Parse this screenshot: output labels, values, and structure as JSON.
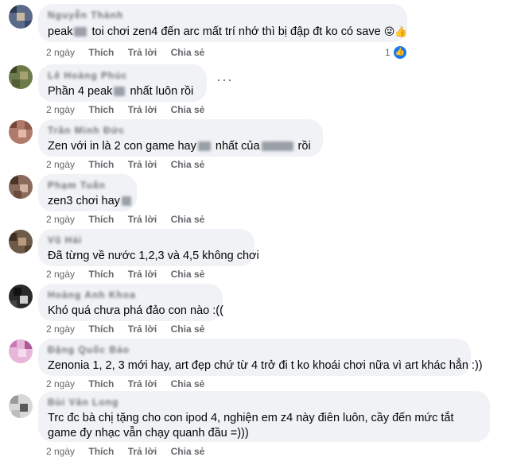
{
  "actions": {
    "time": "2 ngày",
    "like": "Thích",
    "reply": "Trả lời",
    "share": "Chia sẻ"
  },
  "comments": [
    {
      "author": "Nguyễn Thành",
      "text_a": "peak",
      "text_b": "toi chơi zen4 đến arc mất trí nhớ thì bị đập đt ko có save",
      "emoji": "😜👍",
      "reaction_count": "1"
    },
    {
      "author": "Lê Hoàng Phúc",
      "text_a": "Phần 4 peak",
      "text_b": "nhất luôn rồi",
      "more_label": "···"
    },
    {
      "author": "Trần Minh Đức",
      "text_a": "Zen với in là 2 con game hay",
      "text_b": "nhất của",
      "text_c": "rồi"
    },
    {
      "author": "Phạm Tuấn",
      "text_a": "zen3 chơi hay"
    },
    {
      "author": "Vũ Hải",
      "text": "Đã từng về nước 1,2,3 và 4,5 không chơi"
    },
    {
      "author": "Hoàng Anh Khoa",
      "text": "Khó quá chưa phá đảo con nào :(("
    },
    {
      "author": "Đặng Quốc Bảo",
      "text": "Zenonia 1, 2, 3 mới hay, art đẹp chứ từ 4 trở đi t ko khoái chơi nữa vì art khác hẳn :))"
    },
    {
      "author": "Bùi Văn Long",
      "text": "Trc đc bà chị tặng cho con ipod 4, nghiện em z4 này điên luôn, cầy đến mức tắt game đy nhạc vẫn chạy quanh đầu =)))"
    }
  ],
  "colors": {
    "bubble": "#f0f2f5",
    "meta": "#65676b",
    "like_blue": "#1877f2"
  },
  "icons": {
    "like_badge": "thumbs-up-icon"
  }
}
